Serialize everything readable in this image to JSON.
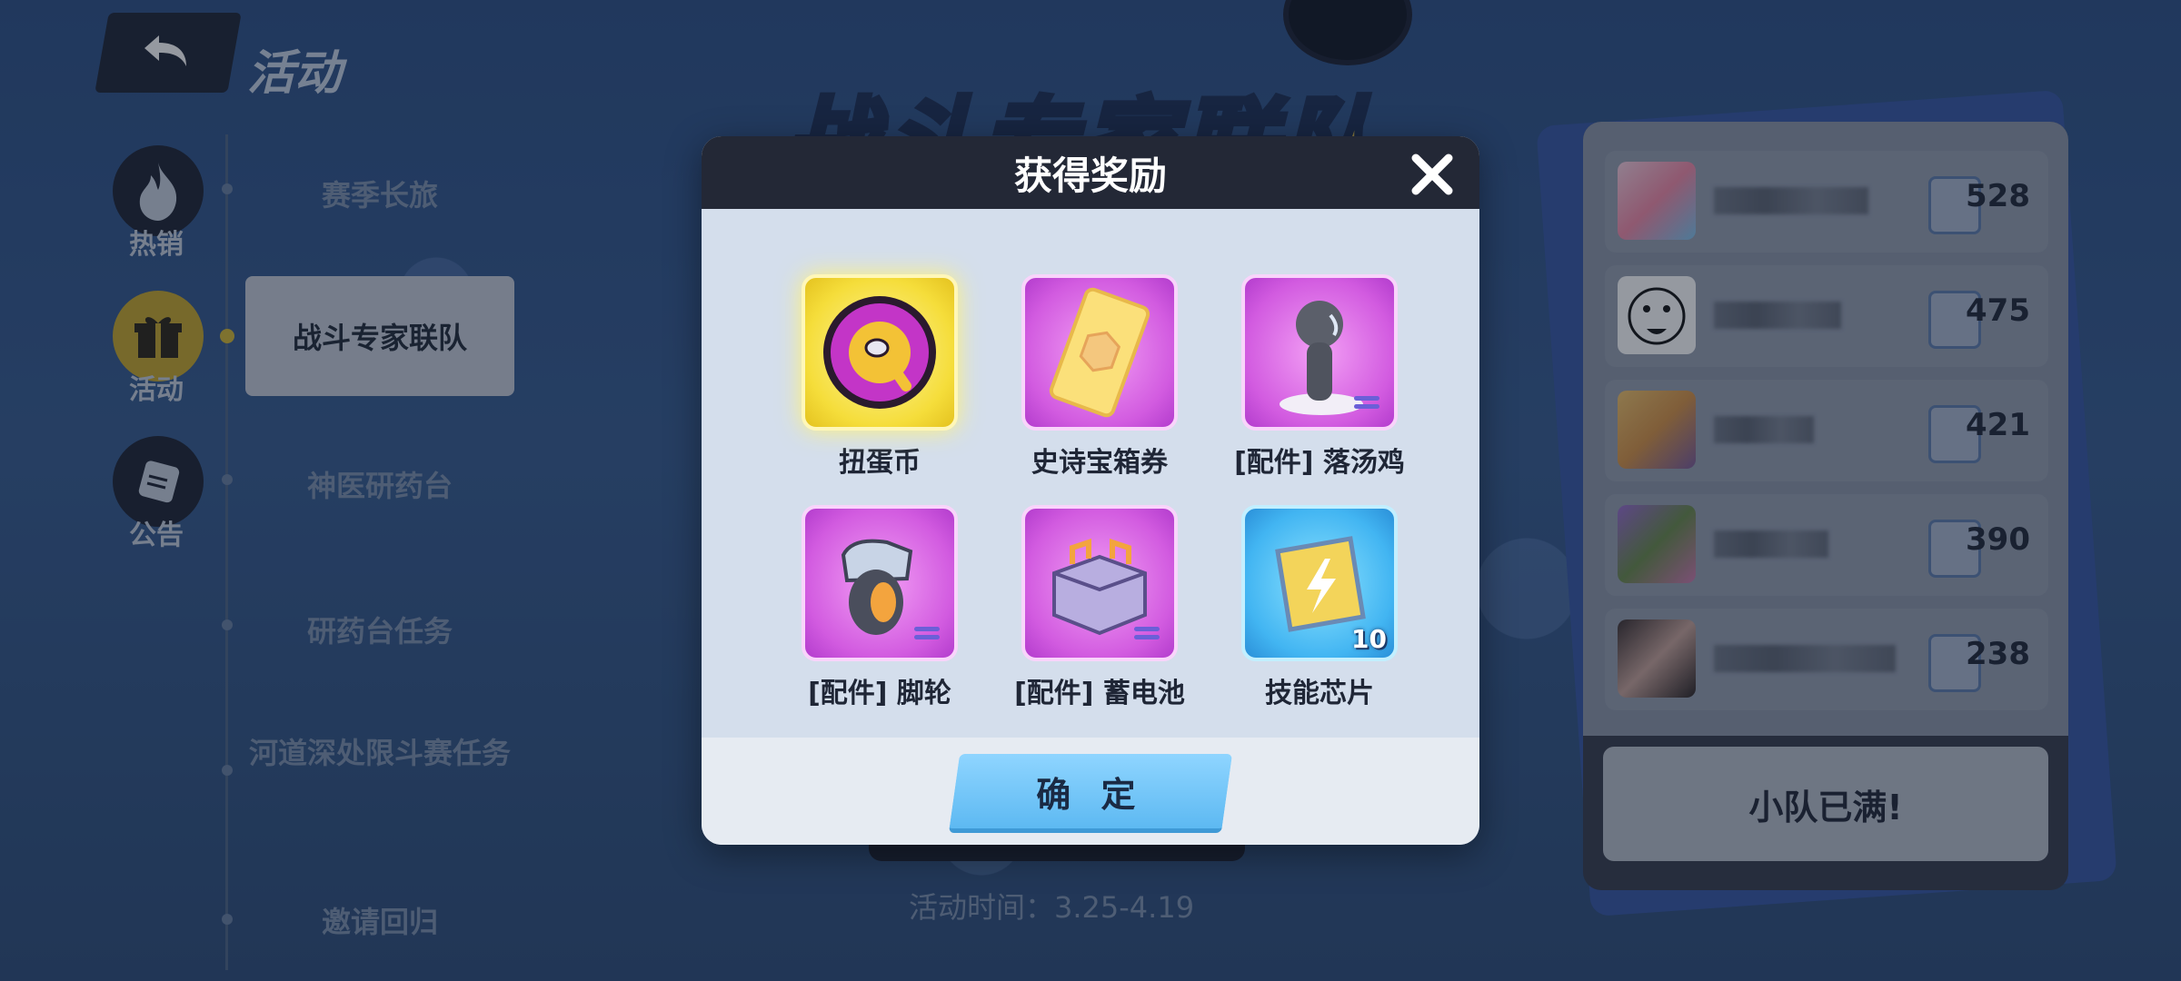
{
  "header": {
    "back_icon": "undo-arrow-icon",
    "title": "活动"
  },
  "banner": {
    "title": "战斗专家联队"
  },
  "side_nav": [
    {
      "label": "热销",
      "icon": "flame-icon"
    },
    {
      "label": "活动",
      "icon": "gift-icon",
      "active": true
    },
    {
      "label": "公告",
      "icon": "scroll-icon"
    }
  ],
  "activity_menu": [
    {
      "label": "赛季长旅"
    },
    {
      "label": "战斗专家联队",
      "active": true
    },
    {
      "label": "神医研药台"
    },
    {
      "label": "研药台任务"
    },
    {
      "label": "河道深处限斗赛任务"
    },
    {
      "label": "邀请回归"
    }
  ],
  "activity_time": "活动时间：3.25-4.19",
  "ranking": {
    "rows": [
      {
        "score": "528"
      },
      {
        "score": "475"
      },
      {
        "score": "421"
      },
      {
        "score": "390"
      },
      {
        "score": "238"
      }
    ],
    "team_full_label": "小队已满!"
  },
  "modal": {
    "title": "获得奖励",
    "close_icon": "close-icon",
    "rewards": [
      {
        "label": "扭蛋币",
        "icon": "gacha-coin-icon",
        "rarity": "gold"
      },
      {
        "label": "史诗宝箱券",
        "icon": "epic-chest-ticket-icon",
        "rarity": "purple"
      },
      {
        "label": "[配件] 落汤鸡",
        "icon": "drenched-figure-icon",
        "rarity": "purple"
      },
      {
        "label": "[配件] 脚轮",
        "icon": "wheel-icon",
        "rarity": "purple"
      },
      {
        "label": "[配件] 蓄电池",
        "icon": "battery-icon",
        "rarity": "purple"
      },
      {
        "label": "技能芯片",
        "icon": "skill-chip-icon",
        "rarity": "blue",
        "quantity": "10"
      }
    ],
    "confirm_label": "确 定"
  },
  "colors": {
    "modal_header": "#232836",
    "confirm_button": "#6cc4f7",
    "gold_tile": "#f5dd3a",
    "purple_tile": "#d25be0",
    "blue_tile": "#42b5f2"
  }
}
